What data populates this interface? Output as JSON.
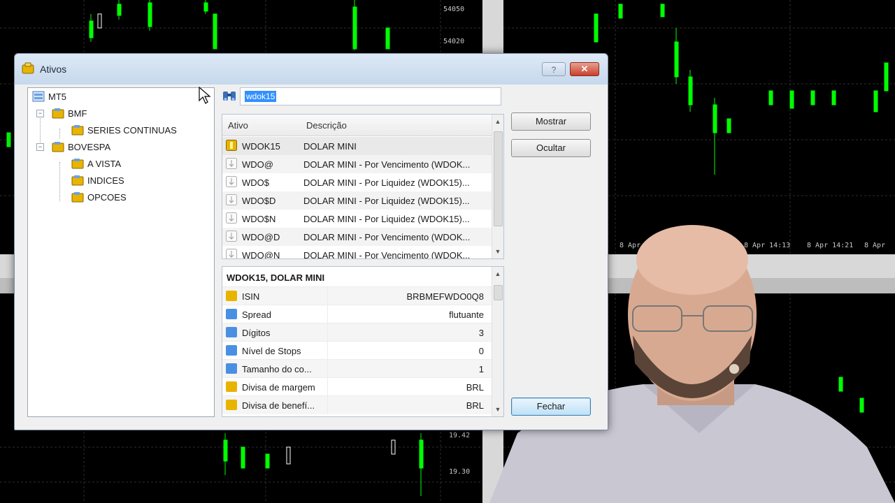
{
  "background": {
    "price_labels": [
      "54050",
      "54020",
      "19.42",
      "19.30"
    ],
    "time_labels": [
      "8 Apr",
      "8 Apr 14:13",
      "8 Apr 14:21",
      "8 Apr"
    ]
  },
  "dialog": {
    "title": "Ativos",
    "help_label": "?",
    "close_label": "✕",
    "tree": [
      {
        "label": "MT5",
        "expander": ""
      },
      {
        "label": "BMF",
        "expander": "−"
      },
      {
        "label": "SERIES CONTINUAS",
        "expander": ""
      },
      {
        "label": "BOVESPA",
        "expander": "−"
      },
      {
        "label": "A VISTA",
        "expander": ""
      },
      {
        "label": "INDICES",
        "expander": ""
      },
      {
        "label": "OPCOES",
        "expander": ""
      }
    ],
    "search": {
      "value": "wdok15"
    },
    "list": {
      "col_symbol": "Ativo",
      "col_description": "Descrição",
      "rows": [
        {
          "symbol": "WDOK15",
          "description": "DOLAR MINI",
          "active": true
        },
        {
          "symbol": "WDO@",
          "description": "DOLAR MINI - Por Vencimento (WDOK...",
          "active": false
        },
        {
          "symbol": "WDO$",
          "description": "DOLAR MINI - Por Liquidez (WDOK15)...",
          "active": false
        },
        {
          "symbol": "WDO$D",
          "description": "DOLAR MINI - Por Liquidez (WDOK15)...",
          "active": false
        },
        {
          "symbol": "WDO$N",
          "description": "DOLAR MINI - Por Liquidez (WDOK15)...",
          "active": false
        },
        {
          "symbol": "WDO@D",
          "description": "DOLAR MINI - Por Vencimento (WDOK...",
          "active": false
        },
        {
          "symbol": "WDO@N",
          "description": "DOLAR MINI - Por Vencimento (WDOK...",
          "active": false
        }
      ]
    },
    "properties": {
      "title": "WDOK15, DOLAR MINI",
      "rows": [
        {
          "name": "ISIN",
          "value": "BRBMEFWDO0Q8",
          "icon": "yellow"
        },
        {
          "name": "Spread",
          "value": "flutuante",
          "icon": "blue"
        },
        {
          "name": "Dígitos",
          "value": "3",
          "icon": "blue"
        },
        {
          "name": "Nível de Stops",
          "value": "0",
          "icon": "blue"
        },
        {
          "name": "Tamanho do co...",
          "value": "1",
          "icon": "blue"
        },
        {
          "name": "Divisa de margem",
          "value": "BRL",
          "icon": "yellow"
        },
        {
          "name": "Divisa de benefí...",
          "value": "BRL",
          "icon": "yellow"
        }
      ]
    },
    "buttons": {
      "show": "Mostrar",
      "hide": "Ocultar",
      "close": "Fechar"
    }
  },
  "colors": {
    "up_candle": "#00ff00",
    "grid": "#3a3a3a",
    "selection": "#3390ff"
  }
}
